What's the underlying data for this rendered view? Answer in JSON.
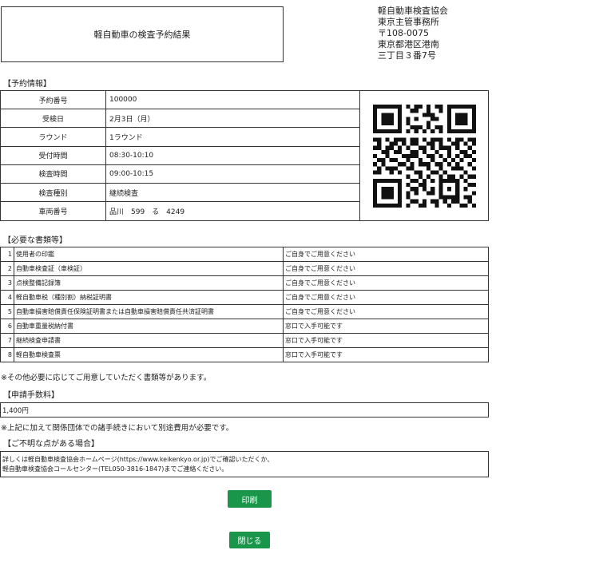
{
  "title": "軽自動車の検査予約結果",
  "org": {
    "name": "軽自動車検査協会",
    "office": "東京主管事務所",
    "postal": "〒108-0075",
    "address1": "東京都港区港南",
    "address2": "三丁目３番7号"
  },
  "reservation": {
    "section_label": "【予約情報】",
    "rows": [
      {
        "label": "予約番号",
        "value": "100000"
      },
      {
        "label": "受検日",
        "value": "2月3日（月）"
      },
      {
        "label": "ラウンド",
        "value": "1ラウンド"
      },
      {
        "label": "受付時間",
        "value": "08:30-10:10"
      },
      {
        "label": "検査時間",
        "value": "09:00-10:15"
      },
      {
        "label": "検査種別",
        "value": "継続検査"
      },
      {
        "label": "車両番号",
        "value": "品川　599　る　4249"
      }
    ]
  },
  "documents": {
    "section_label": "【必要な書類等】",
    "rows": [
      {
        "num": "1",
        "name": "使用者の印鑑",
        "note": "ご自身でご用意ください"
      },
      {
        "num": "2",
        "name": "自動車検査証（車検証）",
        "note": "ご自身でご用意ください"
      },
      {
        "num": "3",
        "name": "点検整備記録簿",
        "note": "ご自身でご用意ください"
      },
      {
        "num": "4",
        "name": "軽自動車税（種別割）納税証明書",
        "note": "ご自身でご用意ください"
      },
      {
        "num": "5",
        "name": "自動車損害賠償責任保険証明書または自動車損害賠償責任共済証明書",
        "note": "ご自身でご用意ください"
      },
      {
        "num": "6",
        "name": "自動車重量税納付書",
        "note": "窓口で入手可能です"
      },
      {
        "num": "7",
        "name": "継続検査申請書",
        "note": "窓口で入手可能です"
      },
      {
        "num": "8",
        "name": "軽自動車検査票",
        "note": "窓口で入手可能です"
      }
    ],
    "note": "※その他必要に応じてご用意していただく書類等があります。"
  },
  "fee": {
    "section_label": "【申請手数料】",
    "value": "1,400円",
    "note": "※上記に加えて関係団体での諸手続きにおいて別途費用が必要です。"
  },
  "contact": {
    "section_label": "【ご不明な点がある場合】",
    "line1": "詳しくは軽自動車検査協会ホームページ(https://www.keikenkyo.or.jp)でご確認いただくか、",
    "line2": "軽自動車検査協会コールセンター(TEL050-3816-1847)までご連絡ください。"
  },
  "buttons": {
    "print": "印刷",
    "close": "閉じる"
  },
  "colors": {
    "button": "#19964a",
    "border": "#333333"
  },
  "qr_icon": "qr-code-icon"
}
